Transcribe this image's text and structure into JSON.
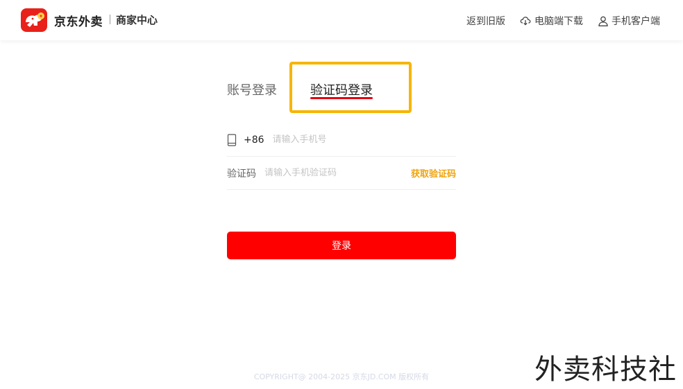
{
  "header": {
    "brand": "京东外卖",
    "subtitle": "商家中心",
    "links": {
      "back": "返到旧版",
      "download": "电脑端下载",
      "mobile": "手机客户端"
    }
  },
  "tabs": {
    "account": "账号登录",
    "sms": "验证码登录",
    "active": "sms"
  },
  "form": {
    "phone_prefix": "+86",
    "phone_placeholder": "请输入手机号",
    "code_label": "验证码",
    "code_placeholder": "请输入手机验证码",
    "get_code": "获取验证码",
    "submit": "登录"
  },
  "footer": {
    "copyright": "COPYRIGHT@ 2004-2025 京东JD.COM 版权所有"
  },
  "watermark": "外卖科技社",
  "colors": {
    "brand_red": "#e8211a",
    "button_red": "#ff0000",
    "underline_red": "#e60012",
    "get_code_orange": "#f0a30a",
    "highlight_yellow": "#f7b500"
  },
  "icons": {
    "logo": "jd-dog-logo-icon",
    "download": "cloud-download-icon",
    "mobile": "user-icon",
    "phone": "phone-icon"
  }
}
